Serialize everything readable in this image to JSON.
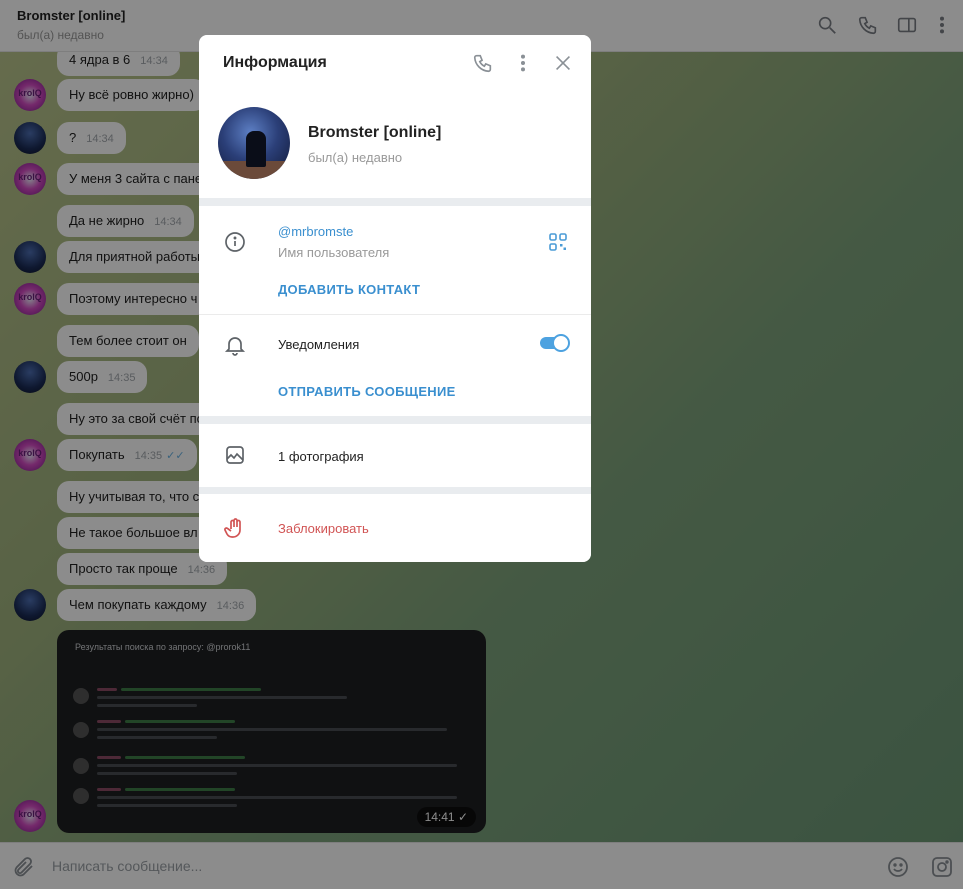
{
  "chat": {
    "title": "Bromster [online]",
    "status": "был(а) недавно",
    "messages": [
      {
        "text": "4 ядра в 6",
        "time": "14:34"
      },
      {
        "text": "Ну всё ровно жирно)"
      },
      {
        "text": "?",
        "time": "14:34"
      },
      {
        "text": "У меня 3 сайта с пане"
      },
      {
        "text": "Да не жирно",
        "time": "14:34"
      },
      {
        "text": "Для приятной работы"
      },
      {
        "text": "Поэтому интересно ч"
      },
      {
        "text": "Тем более стоит он"
      },
      {
        "text": "500р",
        "time": "14:35"
      },
      {
        "text": "Ну это за свой счёт по"
      },
      {
        "text": "Покупать",
        "time": "14:35"
      },
      {
        "text": "Ну учитывая то, что с"
      },
      {
        "text": "Не такое большое вл"
      },
      {
        "text": "Просто так проще",
        "time": "14:36"
      },
      {
        "text": "Чем покупать каждому",
        "time": "14:36"
      }
    ],
    "avatar_krolq_text": "krolQ",
    "media": {
      "title": "Результаты поиска по запросу: @prorok11",
      "time": "14:41"
    },
    "composer_placeholder": "Написать сообщение..."
  },
  "dialog": {
    "title": "Информация",
    "name": "Bromster [online]",
    "status": "был(а) недавно",
    "username": "@mrbromste",
    "username_label": "Имя пользователя",
    "add_contact": "ДОБАВИТЬ КОНТАКТ",
    "notifications_label": "Уведомления",
    "notifications_on": true,
    "send_message": "ОТПРАВИТЬ СООБЩЕНИЕ",
    "photos": "1 фотография",
    "block": "Заблокировать"
  }
}
